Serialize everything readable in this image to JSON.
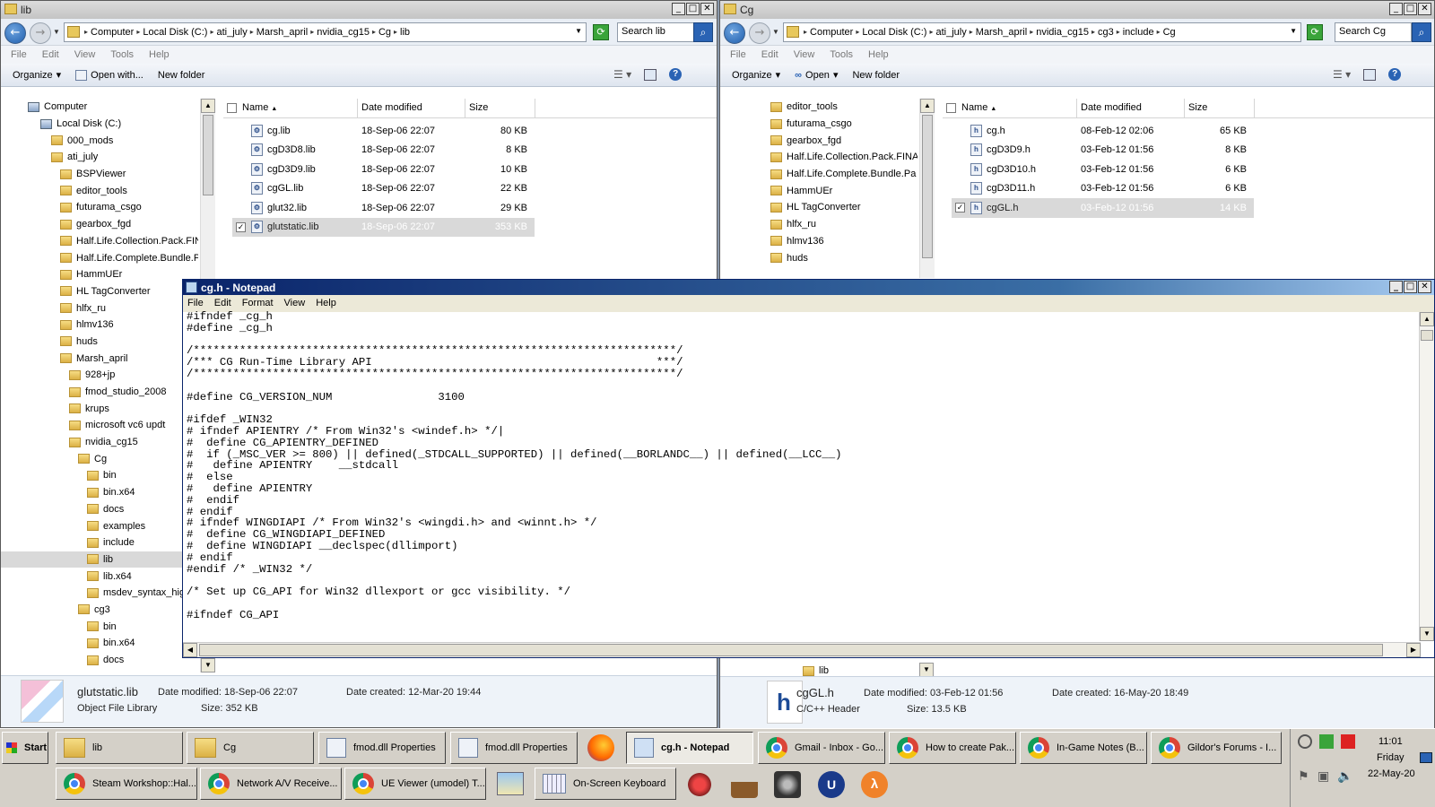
{
  "lib_window": {
    "title": "lib",
    "crumbs": [
      "Computer",
      "Local Disk (C:)",
      "ati_july",
      "Marsh_april",
      "nvidia_cg15",
      "Cg",
      "lib"
    ],
    "search_placeholder": "Search lib",
    "menu": [
      "File",
      "Edit",
      "View",
      "Tools",
      "Help"
    ],
    "commands": {
      "organize": "Organize",
      "open_with": "Open with...",
      "new_folder": "New folder"
    },
    "tree": [
      "Computer",
      "Local Disk (C:)",
      "000_mods",
      "ati_july",
      "BSPViewer",
      "editor_tools",
      "futurama_csgo",
      "gearbox_fgd",
      "Half.Life.Collection.Pack.FINA",
      "Half.Life.Complete.Bundle.Pa",
      "HammUEr",
      "HL TagConverter",
      "hlfx_ru",
      "hlmv136",
      "huds",
      "Marsh_april",
      "928+jp",
      "fmod_studio_2008",
      "krups",
      "microsoft vc6 updt",
      "nvidia_cg15",
      "Cg",
      "bin",
      "bin.x64",
      "docs",
      "examples",
      "include",
      "lib",
      "lib.x64",
      "msdev_syntax_hig",
      "cg3",
      "bin",
      "bin.x64",
      "docs"
    ],
    "columns": {
      "name": "Name",
      "date": "Date modified",
      "size": "Size"
    },
    "files": [
      {
        "name": "cg.lib",
        "date": "18-Sep-06 22:07",
        "size": "80 KB"
      },
      {
        "name": "cgD3D8.lib",
        "date": "18-Sep-06 22:07",
        "size": "8 KB"
      },
      {
        "name": "cgD3D9.lib",
        "date": "18-Sep-06 22:07",
        "size": "10 KB"
      },
      {
        "name": "cgGL.lib",
        "date": "18-Sep-06 22:07",
        "size": "22 KB"
      },
      {
        "name": "glut32.lib",
        "date": "18-Sep-06 22:07",
        "size": "29 KB"
      },
      {
        "name": "glutstatic.lib",
        "date": "18-Sep-06 22:07",
        "size": "353 KB"
      }
    ],
    "details": {
      "name": "glutstatic.lib",
      "type": "Object File Library",
      "modified": "Date modified: 18-Sep-06 22:07",
      "created": "Date created: 12-Mar-20 19:44",
      "size": "Size: 352 KB"
    }
  },
  "cg_window": {
    "title": "Cg",
    "crumbs": [
      "Computer",
      "Local Disk (C:)",
      "ati_july",
      "Marsh_april",
      "nvidia_cg15",
      "cg3",
      "include",
      "Cg"
    ],
    "search_placeholder": "Search Cg",
    "menu": [
      "File",
      "Edit",
      "View",
      "Tools",
      "Help"
    ],
    "commands": {
      "organize": "Organize",
      "open": "Open",
      "new_folder": "New folder"
    },
    "tree": [
      "editor_tools",
      "futurama_csgo",
      "gearbox_fgd",
      "Half.Life.Collection.Pack.FINA",
      "Half.Life.Complete.Bundle.Pa",
      "HammUEr",
      "HL TagConverter",
      "hlfx_ru",
      "hlmv136",
      "huds"
    ],
    "tree_bottom": "lib",
    "columns": {
      "name": "Name",
      "date": "Date modified",
      "size": "Size"
    },
    "files": [
      {
        "name": "cg.h",
        "date": "08-Feb-12 02:06",
        "size": "65 KB"
      },
      {
        "name": "cgD3D9.h",
        "date": "03-Feb-12 01:56",
        "size": "8 KB"
      },
      {
        "name": "cgD3D10.h",
        "date": "03-Feb-12 01:56",
        "size": "6 KB"
      },
      {
        "name": "cgD3D11.h",
        "date": "03-Feb-12 01:56",
        "size": "6 KB"
      },
      {
        "name": "cgGL.h",
        "date": "03-Feb-12 01:56",
        "size": "14 KB"
      }
    ],
    "details": {
      "name": "cgGL.h",
      "type": "C/C++ Header",
      "modified": "Date modified: 03-Feb-12 01:56",
      "created": "Date created: 16-May-20 18:49",
      "size": "Size: 13.5 KB"
    }
  },
  "notepad": {
    "title": "cg.h - Notepad",
    "menu": [
      "File",
      "Edit",
      "Format",
      "View",
      "Help"
    ],
    "text": "#ifndef _cg_h\n#define _cg_h\n\n/*************************************************************************/\n/*** CG Run-Time Library API                                           ***/\n/*************************************************************************/\n\n#define CG_VERSION_NUM                3100\n\n#ifdef _WIN32\n# ifndef APIENTRY /* From Win32's <windef.h> */|\n#  define CG_APIENTRY_DEFINED\n#  if (_MSC_VER >= 800) || defined(_STDCALL_SUPPORTED) || defined(__BORLANDC__) || defined(__LCC__)\n#   define APIENTRY    __stdcall\n#  else\n#   define APIENTRY\n#  endif\n# endif\n# ifndef WINGDIAPI /* From Win32's <wingdi.h> and <winnt.h> */\n#  define CG_WINGDIAPI_DEFINED\n#  define WINGDIAPI __declspec(dllimport)\n# endif\n#endif /* _WIN32 */\n\n/* Set up CG_API for Win32 dllexport or gcc visibility. */\n\n#ifndef CG_API"
  },
  "taskbar": {
    "start": "Start",
    "row1": [
      "lib",
      "Cg",
      "fmod.dll Properties",
      "fmod.dll Properties",
      "cg.h - Notepad",
      "Gmail - Inbox - Go...",
      "How to create Pak...",
      "In-Game Notes (B...",
      "Gildor's Forums - I..."
    ],
    "row2": [
      "Steam Workshop::Hal...",
      "Network A/V Receive...",
      "UE Viewer (umodel) T...",
      "On-Screen Keyboard"
    ],
    "clock": {
      "time": "11:01",
      "day": "Friday",
      "date": "22-May-20"
    }
  }
}
